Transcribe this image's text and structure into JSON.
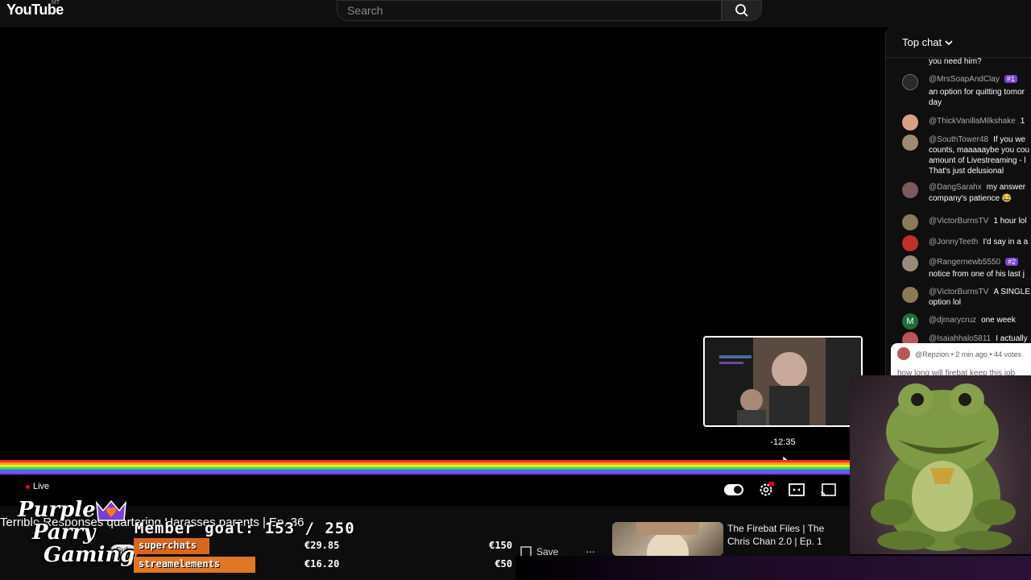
{
  "header": {
    "logo_text": "YouTube",
    "logo_sup": "MT",
    "search_placeholder": "Search"
  },
  "player": {
    "live_label": "Live",
    "preview_time": "-12:35"
  },
  "video": {
    "title": "Terrible Responses quartering Harasses parents | Ep. 36",
    "save_label": "Save",
    "subscribe_label": "Sub",
    "more_label": "..."
  },
  "recommended": {
    "title": "The Firebat Files | The Chris Chan 2.0 | Ep. 1"
  },
  "overlay": {
    "logo_lines": [
      "Purple",
      "Parry",
      "Gaming"
    ],
    "goal_text": "Member goal: 153 / 250",
    "bars": [
      {
        "label": "superchats",
        "amount": "€29.85",
        "target": "€150",
        "progress": 0.2,
        "color": "#d9661a"
      },
      {
        "label": "streamelements",
        "amount": "€16.20",
        "target": "€50",
        "progress": 0.32,
        "color": "#e07722"
      }
    ]
  },
  "chat": {
    "filter_label": "Top chat",
    "messages": [
      {
        "author": "",
        "text": "you need him?",
        "avatar_color": "#444"
      },
      {
        "author": "@MrsSoapAndClay",
        "badge": "#1",
        "text": "an option for quitting tomor",
        "text2": "day",
        "avatar_color": "#333"
      },
      {
        "author": "@ThickVanillaMilkshake",
        "inline": "1",
        "avatar_color": "#d9a088"
      },
      {
        "author": "@SouthTower48",
        "inline": "If you we",
        "text": "counts, maaaaaybe you cou",
        "text2": "amount of Livestreaming - l",
        "text3": "That's just delusional",
        "avatar_color": "#a08a70"
      },
      {
        "author": "@DangSarahx",
        "inline": "my answer",
        "text": "company's patience 😂",
        "avatar_color": "#7a5a5a"
      },
      {
        "author": "@VictorBurnsTV",
        "inline": "1 hour lol",
        "avatar_color": "#8a7a5a"
      },
      {
        "author": "@JonnyTeeth",
        "inline": "I'd say in a a",
        "avatar_color": "#c0302a"
      },
      {
        "author": "@Rangernewb5550",
        "badge": "#2",
        "text": "notice from one of his last j",
        "avatar_color": "#9a8a7a"
      },
      {
        "author": "@VictorBurnsTV",
        "inline": "A SINGLE",
        "text": "option lol",
        "avatar_color": "#8a7a5a"
      },
      {
        "author": "@djmarycruz",
        "inline": "one week",
        "avatar_letter": "M",
        "avatar_color": "#1f6b3a"
      },
      {
        "author": "@Isaiahhalo5811",
        "inline": "I actually",
        "avatar_color": "#b55"
      }
    ]
  },
  "poll": {
    "meta": "@Repzion • 2 min ago • 44 votes",
    "question": "how long will firebat keep this job"
  },
  "colors": {
    "accent_red": "#ff0000",
    "member_badge": "#7b3fd6"
  }
}
